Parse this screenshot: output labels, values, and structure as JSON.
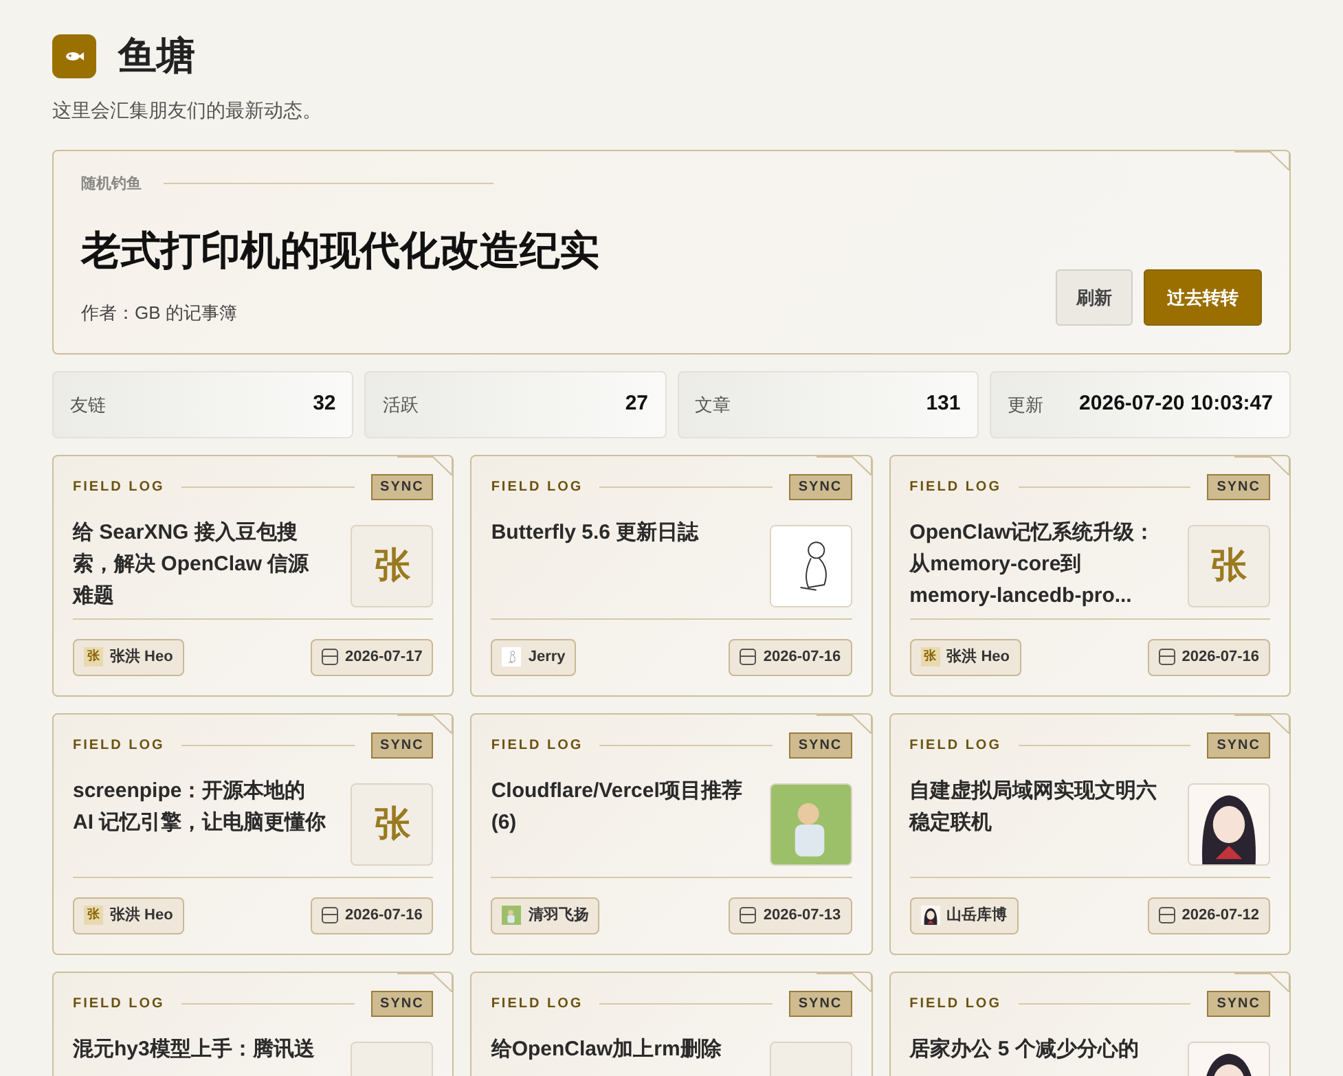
{
  "header": {
    "title": "鱼塘",
    "subtitle": "这里会汇集朋友们的最新动态。"
  },
  "featured": {
    "label": "随机钓鱼",
    "title": "老式打印机的现代化改造纪实",
    "author": "作者：GB 的记事簿",
    "buttons": [
      {
        "label": "刷新",
        "primary": false
      },
      {
        "label": "过去转转",
        "primary": true
      }
    ]
  },
  "stats": [
    {
      "label": "友链",
      "value": "32"
    },
    {
      "label": "活跃",
      "value": "27"
    },
    {
      "label": "文章",
      "value": "131"
    },
    {
      "label": "更新",
      "value": "2026-07-20 10:03:47"
    }
  ],
  "posts": [
    {
      "tag": "FIELD LOG",
      "badge": "SYNC",
      "title": "给 SearXNG 接入豆包搜索，解决 OpenClaw 信源难题",
      "thumb": {
        "kind": "letter",
        "text": "张"
      },
      "author": {
        "name": "张洪 Heo",
        "avatar": {
          "kind": "letter",
          "text": "张"
        }
      },
      "date": "2026-07-17"
    },
    {
      "tag": "FIELD LOG",
      "badge": "SYNC",
      "title": "Butterfly 5.6 更新日誌",
      "thumb": {
        "kind": "sketch"
      },
      "author": {
        "name": "Jerry",
        "avatar": {
          "kind": "sketch"
        }
      },
      "date": "2026-07-16"
    },
    {
      "tag": "FIELD LOG",
      "badge": "SYNC",
      "title": "OpenClaw记忆系统升级：从memory-core到memory-lancedb-pro...",
      "thumb": {
        "kind": "letter",
        "text": "张"
      },
      "author": {
        "name": "张洪 Heo",
        "avatar": {
          "kind": "letter",
          "text": "张"
        }
      },
      "date": "2026-07-16"
    },
    {
      "tag": "FIELD LOG",
      "badge": "SYNC",
      "title": "screenpipe：开源本地的 AI 记忆引擎，让电脑更懂你",
      "thumb": {
        "kind": "letter",
        "text": "张"
      },
      "author": {
        "name": "张洪 Heo",
        "avatar": {
          "kind": "letter",
          "text": "张"
        }
      },
      "date": "2026-07-16"
    },
    {
      "tag": "FIELD LOG",
      "badge": "SYNC",
      "title": "Cloudflare/Vercel项目推荐(6)",
      "thumb": {
        "kind": "photo"
      },
      "author": {
        "name": "清羽飞扬",
        "avatar": {
          "kind": "photo"
        }
      },
      "date": "2026-07-13"
    },
    {
      "tag": "FIELD LOG",
      "badge": "SYNC",
      "title": "自建虚拟局域网实现文明六稳定联机",
      "thumb": {
        "kind": "avatar"
      },
      "author": {
        "name": "山岳库博",
        "avatar": {
          "kind": "avatar"
        }
      },
      "date": "2026-07-12"
    },
    {
      "tag": "FIELD LOG",
      "badge": "SYNC",
      "title": "混元hy3模型上手：腾讯送",
      "thumb": {
        "kind": "letter"
      }
    },
    {
      "tag": "FIELD LOG",
      "badge": "SYNC",
      "title": "给OpenClaw加上rm删除",
      "thumb": {
        "kind": "letter"
      }
    },
    {
      "tag": "FIELD LOG",
      "badge": "SYNC",
      "title": "居家办公 5 个减少分心的",
      "thumb": {
        "kind": "avatar"
      }
    }
  ]
}
